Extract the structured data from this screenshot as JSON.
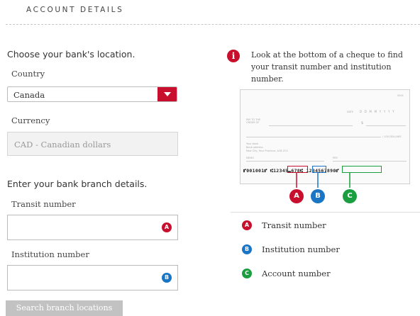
{
  "page": {
    "title": "ACCOUNT DETAILS"
  },
  "location": {
    "heading": "Choose your bank's location.",
    "country_label": "Country",
    "country_value": "Canada",
    "currency_label": "Currency",
    "currency_value": "CAD - Canadian dollars"
  },
  "branch": {
    "heading": "Enter your bank branch details.",
    "transit_label": "Transit number",
    "transit_value": "",
    "transit_badge": "A",
    "institution_label": "Institution number",
    "institution_value": "",
    "institution_badge": "B",
    "search_button": "Search branch locations"
  },
  "info": {
    "text": "Look at the bottom of a cheque to find your transit number and institution number.",
    "icon": "info-icon"
  },
  "cheque": {
    "number": "0001",
    "date_label": "DATE",
    "date_format": "D D M M Y Y Y Y",
    "pay_to_label": "PAY TO THE ORDER OF",
    "dollar_sign": "$",
    "dollars_label": "/ 100 DOLLARS",
    "bank_lines": [
      "Your bank",
      "Bank address",
      "New City, Your Province, A1B 2C3"
    ],
    "memo_label": "MEMO",
    "sign_label": "PER",
    "micr_start": "⑈001001⑈ ⑆",
    "micr_transit": "12345",
    "micr_sep": "⑉",
    "micr_institution": "678",
    "micr_mid": "⑆ ",
    "micr_account": "1234567890",
    "micr_end": "⑈",
    "badges": [
      "A",
      "B",
      "C"
    ]
  },
  "legend": {
    "items": [
      {
        "badge": "A",
        "label": "Transit number"
      },
      {
        "badge": "B",
        "label": "Institution number"
      },
      {
        "badge": "C",
        "label": "Account number"
      }
    ]
  },
  "colors": {
    "brand_red": "#c8102e",
    "badge_blue": "#1a75c4",
    "badge_green": "#1a9e3f"
  }
}
